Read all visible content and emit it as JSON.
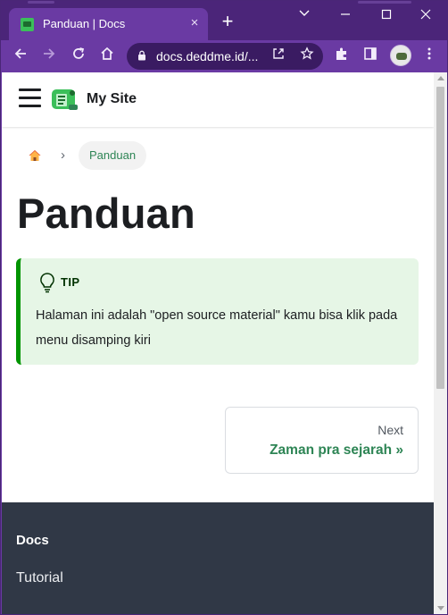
{
  "browser": {
    "tab": {
      "title": "Panduan | Docs",
      "close_icon": "×"
    },
    "new_tab_icon": "+",
    "window_controls": {
      "dropdown": "⌄",
      "minimize": "—",
      "maximize": "☐",
      "close": "✕"
    },
    "toolbar": {
      "back_icon": "←",
      "forward_icon": "→",
      "reload_icon": "↻",
      "home_icon": "⌂",
      "url": "docs.deddme.id/...",
      "share_icon": "⇪",
      "bookmark_icon": "☆",
      "extensions_icon": "puzzle",
      "sidepanel_icon": "panel",
      "menu_icon": "⋮"
    },
    "colors": {
      "frame": "#4b2579",
      "toolbar": "#6a3aa3",
      "omnibox": "#3a1b62"
    }
  },
  "site": {
    "navbar": {
      "title": "My Site"
    },
    "breadcrumb": {
      "separator": "›",
      "current": "Panduan"
    },
    "page": {
      "title": "Panduan"
    },
    "admonition": {
      "heading": "TIP",
      "body": "Halaman ini adalah \"open source material\" kamu bisa klik pada menu disamping kiri"
    },
    "pagination": {
      "sublabel": "Next",
      "label": "Zaman pra sejarah »"
    },
    "footer": {
      "title": "Docs",
      "link": "Tutorial"
    },
    "colors": {
      "primary": "#2e8555",
      "tip_border": "#009400",
      "tip_bg": "#e6f6e6",
      "footer_bg": "#303846"
    }
  }
}
